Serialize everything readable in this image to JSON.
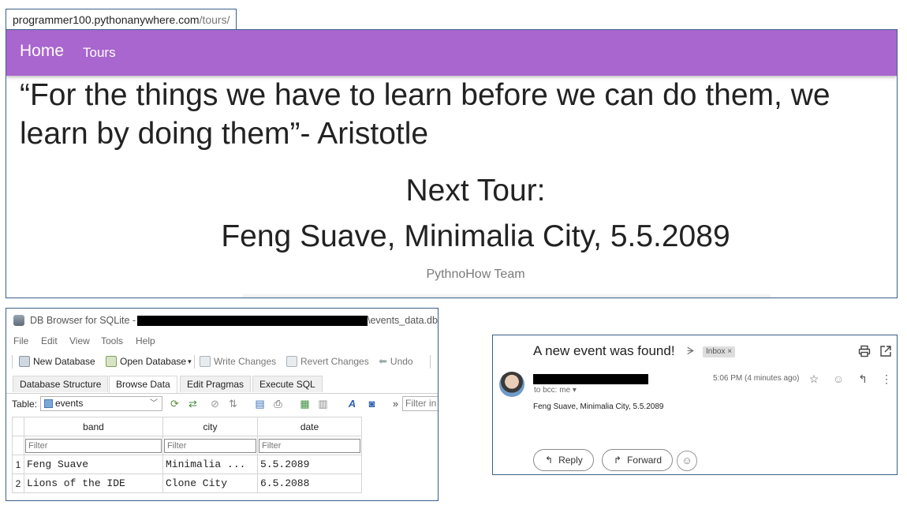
{
  "browser": {
    "url_host": "programmer100.pythonanywhere.com",
    "url_path": "/tours/"
  },
  "site": {
    "nav": {
      "home": "Home",
      "tours": "Tours"
    },
    "quote": "“For the things we have to learn before we can do them, we learn by doing them”- Aristotle",
    "next_label": "Next Tour:",
    "next_value": "Feng Suave, Minimalia City, 5.5.2089",
    "team": "PythnoHow Team",
    "accent": "#a966cf"
  },
  "db_browser": {
    "title": "DB Browser for SQLite -",
    "file": "\\events_data.db",
    "menu": [
      "File",
      "Edit",
      "View",
      "Tools",
      "Help"
    ],
    "toolbar": {
      "new_db": "New Database",
      "open_db": "Open Database",
      "write": "Write Changes",
      "revert": "Revert Changes",
      "undo": "Undo"
    },
    "tabs": [
      "Database Structure",
      "Browse Data",
      "Edit Pragmas",
      "Execute SQL"
    ],
    "active_tab": "Browse Data",
    "table_label": "Table:",
    "table_selected": "events",
    "more": "»",
    "filter_all_placeholder": "Filter in a",
    "columns": [
      "band",
      "city",
      "date"
    ],
    "filter_placeholder": "Filter",
    "rows": [
      {
        "num": "1",
        "band": "Feng Suave",
        "city": "Minimalia ...",
        "date": "5.5.2089"
      },
      {
        "num": "2",
        "band": "Lions of the IDE",
        "city": "Clone City",
        "date": "6.5.2088"
      }
    ]
  },
  "email": {
    "subject": "A new event was found!",
    "label": "Inbox ×",
    "to": "to bcc: me ▾",
    "time": "5:06 PM (4 minutes ago)",
    "body": "Feng Suave, Minimalia City, 5.5.2089",
    "reply": "Reply",
    "forward": "Forward"
  }
}
